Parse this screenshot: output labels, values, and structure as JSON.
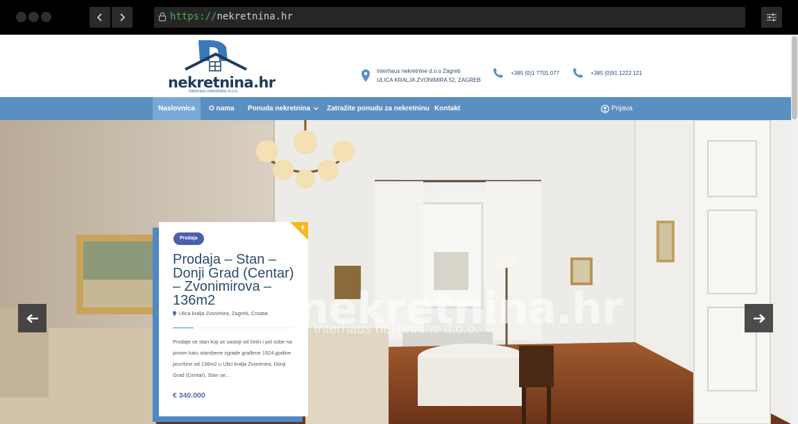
{
  "browser": {
    "url_scheme": "https://",
    "url_host": "nekretnina.hr"
  },
  "header": {
    "logo_text": "nekretnina.hr",
    "logo_sub": "Interhaus nekretnine d.o.o.",
    "address_line1": "Interhaus nekretnine d.o.o Zagreb",
    "address_line2": "ULICA KRALJA ZVONIMIRA 52, ZAGREB",
    "phone1": "+385 (0)1 7701 077",
    "phone2": "+385 (0)91 1222 121"
  },
  "nav": {
    "items": [
      "Naslovnica",
      "O nama",
      "Ponuda nekretnina",
      "Zatražite ponudu za nekretninu",
      "Kontakt"
    ],
    "login": "Prijava"
  },
  "listing": {
    "badge": "Prodaja",
    "title": "Prodaja – Stan – Donji Grad (Centar) – Zvonimirova – 136m2",
    "location": "Ulica kralja Zvonimira, Zagreb, Croatia",
    "description": "Prodaje se  stan koji se sastoji od četiri i pol sobe na prvom katu stambene zgrade građene 1924.godine površine od 136m2 u Ulici kralja Zvonimira, Donji Grad (Centar). Stan se...",
    "price": "€ 340.000"
  },
  "watermark": {
    "line1": "nekretnina.hr",
    "line2": "Interhaus nekretnine d.o.o."
  },
  "colors": {
    "nav_bg": "#5a8fc2",
    "nav_active": "#79a8d6",
    "badge": "#4a5fa8",
    "price": "#4a6fb0",
    "corner_flag": "#f5b921"
  }
}
